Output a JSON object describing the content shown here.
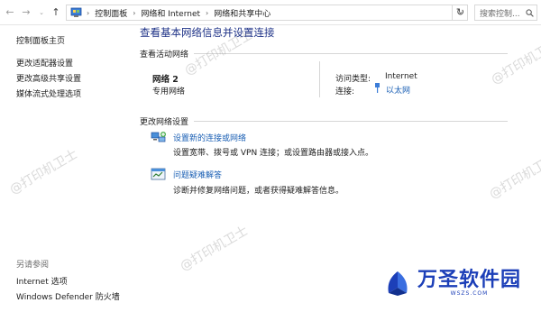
{
  "address_bar": {
    "back_icon": "arrow-left-icon",
    "forward_icon": "arrow-right-icon",
    "recent_icon": "chevron-down-icon",
    "up_icon": "arrow-up-icon",
    "crumbs": [
      "控制面板",
      "网络和 Internet",
      "网络和共享中心"
    ],
    "refresh_icon": "refresh-icon",
    "search_placeholder": "搜索控制..."
  },
  "left_pane": {
    "links": [
      "控制面板主页",
      "更改适配器设置",
      "更改高级共享设置",
      "媒体流式处理选项"
    ],
    "see_also_label": "另请参阅",
    "see_also_links": [
      "Internet 选项",
      "Windows Defender 防火墙"
    ]
  },
  "main": {
    "title": "查看基本网络信息并设置连接",
    "active_networks_heading": "查看活动网络",
    "network": {
      "name": "网络 2",
      "type": "专用网络",
      "access_type_label": "访问类型:",
      "access_type_value": "Internet",
      "connections_label": "连接:",
      "connections_value": "以太网"
    },
    "change_settings_heading": "更改网络设置",
    "tasks": [
      {
        "link": "设置新的连接或网络",
        "desc": "设置宽带、拨号或 VPN 连接；或设置路由器或接入点。",
        "icon": "new-connection-icon"
      },
      {
        "link": "问题疑难解答",
        "desc": "诊断并修复网络问题，或者获得疑难解答信息。",
        "icon": "troubleshoot-icon"
      }
    ]
  },
  "watermark": {
    "text": "@打印机卫士",
    "brand_name": "万圣软件园",
    "brand_sub": "WSZS.COM"
  },
  "colors": {
    "title_blue": "#1e3287",
    "link_blue": "#1a5fb4",
    "brand_blue": "#1c3fb8"
  }
}
